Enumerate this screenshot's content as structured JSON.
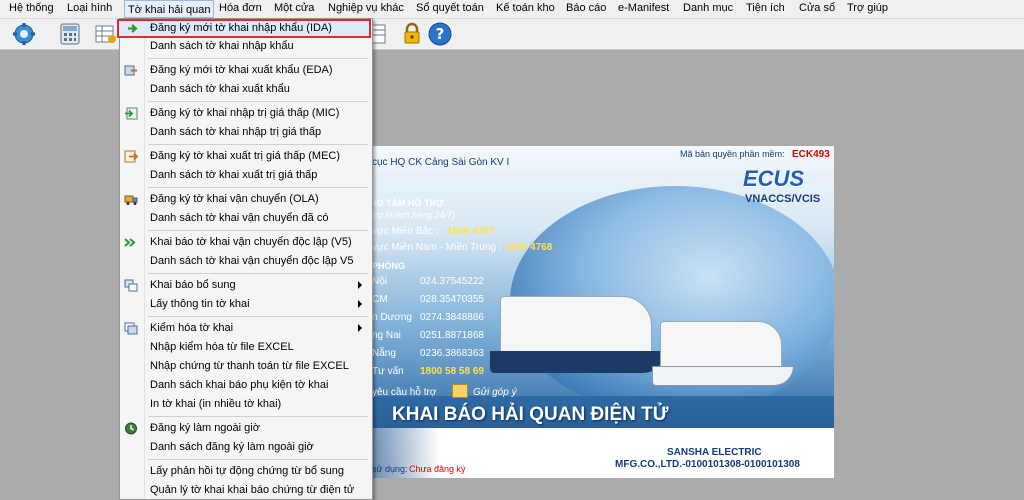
{
  "menubar": {
    "items": [
      "Hệ thống",
      "Loại hình",
      "Tờ khai hải quan",
      "Hóa đơn",
      "Một cửa",
      "Nghiệp vụ khác",
      "Sổ quyết toán",
      "Kế toán kho",
      "Báo cáo",
      "e-Manifest",
      "Danh mục",
      "Tiện ích",
      "Cửa sổ",
      "Trợ giúp"
    ]
  },
  "toolbar": {
    "icons": [
      "gear-icon",
      "calculator-icon",
      "table-icon",
      "lock-icon",
      "help-icon"
    ]
  },
  "dropdown": {
    "items": [
      {
        "label": "Đăng ký mới tờ khai nhập khẩu (IDA)",
        "icon": "green-arrow-icon",
        "submenu": false,
        "highlighted": true
      },
      {
        "label": "Danh sách tờ khai nhập khẩu",
        "icon": "",
        "submenu": false
      },
      {
        "label": "Đăng ký mới tờ khai xuất khẩu (EDA)",
        "icon": "export-icon",
        "submenu": false
      },
      {
        "label": "Danh sách tờ khai xuất khẩu",
        "icon": "",
        "submenu": false
      },
      {
        "label": "Đăng ký tờ khai nhập trị giá thấp (MIC)",
        "icon": "import-low-icon",
        "submenu": false
      },
      {
        "label": "Danh sách tờ khai nhập trị giá thấp",
        "icon": "",
        "submenu": false
      },
      {
        "label": "Đăng ký tờ khai xuất trị giá thấp (MEC)",
        "icon": "export-low-icon",
        "submenu": false
      },
      {
        "label": "Danh sách tờ khai xuất trị giá thấp",
        "icon": "",
        "submenu": false
      },
      {
        "label": "Đăng ký tờ khai vận chuyển (OLA)",
        "icon": "truck-icon",
        "submenu": false
      },
      {
        "label": "Danh sách tờ khai vận chuyển đã có",
        "icon": "",
        "submenu": false
      },
      {
        "label": "Khai báo tờ khai vận chuyển độc lập (V5)",
        "icon": "double-arrow-icon",
        "submenu": false
      },
      {
        "label": "Danh sách tờ khai vận chuyển độc lập V5",
        "icon": "",
        "submenu": false
      },
      {
        "label": "Khai báo bổ sung",
        "icon": "supplement-icon",
        "submenu": true
      },
      {
        "label": "Lấy thông tin tờ khai",
        "icon": "",
        "submenu": true
      },
      {
        "label": "Kiểm hóa tờ khai",
        "icon": "inspect-icon",
        "submenu": true
      },
      {
        "label": "Nhập kiểm hóa từ file EXCEL",
        "icon": "",
        "submenu": false
      },
      {
        "label": "Nhập chứng từ thanh toán từ file EXCEL",
        "icon": "",
        "submenu": false
      },
      {
        "label": "Danh sách khai báo phụ kiện tờ khai",
        "icon": "",
        "submenu": false
      },
      {
        "label": "In tờ khai (in nhiều tờ khai)",
        "icon": "",
        "submenu": false
      },
      {
        "label": "Đăng ký làm ngoài giờ",
        "icon": "clock-icon",
        "submenu": false
      },
      {
        "label": "Danh sách đăng ký làm ngoài giờ",
        "icon": "",
        "submenu": false
      },
      {
        "label": "Lấy phản hồi tự động chứng từ bổ sung",
        "icon": "",
        "submenu": false
      },
      {
        "label": "Quản lý tờ khai khai báo chứng từ điện tử",
        "icon": "",
        "submenu": false
      }
    ]
  },
  "splash": {
    "agency_partial": "cục HQ CK Cảng Sài Gòn KV I",
    "license_label": "Mã bản quyền phần mềm:",
    "license_code": "ECK493",
    "brand": "ECUS",
    "brand_sub": "VNACCS/VCIS",
    "support_title": "NG TÂM HỖ TRỢ",
    "support_sub": "trợ khách hàng 24/7)",
    "north_label": "vực Miền Bắc :",
    "north_phone": "1900 4767",
    "south_label": "vực Miền Nam - Miền Trung :",
    "south_phone": "1900 4768",
    "offices_title": "PHÒNG",
    "offices": [
      {
        "name": "Nội",
        "phone": "024.37545222"
      },
      {
        "name": "CM",
        "phone": "028.35470355"
      },
      {
        "name": "n Dương",
        "phone": "0274.3848886"
      },
      {
        "name": "ng Nai",
        "phone": "0251.8871868"
      },
      {
        "name": "Nẵng",
        "phone": "0236.3868363"
      },
      {
        "name": "Tư vấn",
        "phone": "1800 58 58 69"
      }
    ],
    "request_support": "yêu cầu hỗ trợ",
    "feedback": "Gửi góp ý",
    "banner": "KHAI BÁO HẢI QUAN ĐIỆN TỬ",
    "company_line1": "SANSHA ELECTRIC",
    "company_line2": "MFG.CO.,LTD.-0100101308-0100101308",
    "status_label": "sử dụng:",
    "status_value": "Chưa đăng ký"
  }
}
